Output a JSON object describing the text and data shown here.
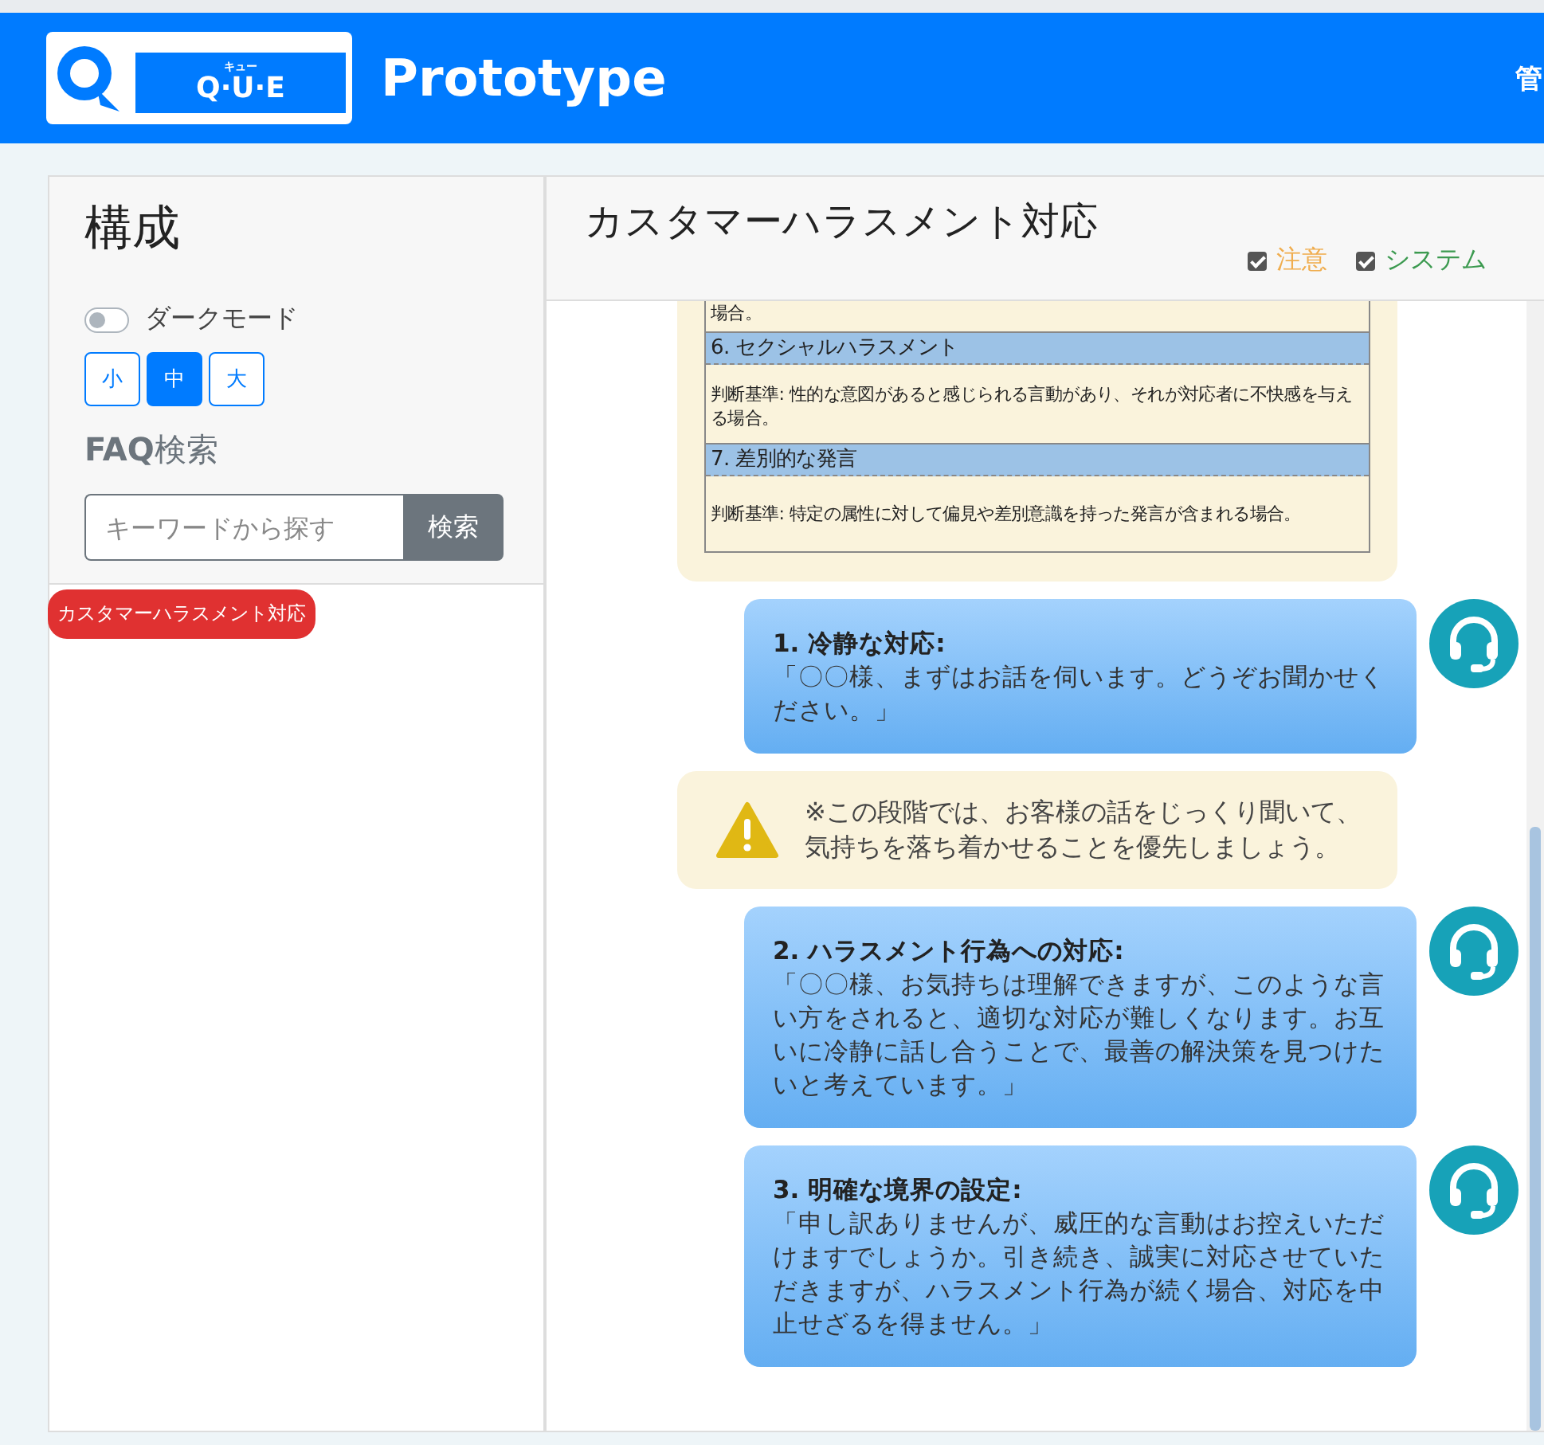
{
  "header": {
    "logo": {
      "ruby": "キュー",
      "text": "Q·U·E"
    },
    "title": "Prototype",
    "user": "管"
  },
  "sidebar": {
    "title": "構成",
    "dark_mode": {
      "label": "ダークモード",
      "on": false
    },
    "font_sizes": [
      {
        "label": "小",
        "selected": false
      },
      {
        "label": "中",
        "selected": true
      },
      {
        "label": "大",
        "selected": false
      }
    ],
    "faq_title": "**FAQ**検索",
    "search": {
      "placeholder": "キーワードから探す",
      "button": "検索"
    },
    "tags": [
      {
        "label": "カスタマーハラスメント対応"
      }
    ]
  },
  "main": {
    "title": "カスタマーハラスメント対応",
    "filters": [
      {
        "label": "注意",
        "checked": true,
        "color": "#f0ad4e"
      },
      {
        "label": "システム",
        "checked": true,
        "color": "#3c9a50"
      }
    ],
    "messages": [
      {
        "kind": "table",
        "rows": [
          {
            "kind": "text",
            "text": "場合。"
          },
          {
            "kind": "heading",
            "text": "6. セクシャルハラスメント"
          },
          {
            "kind": "text",
            "text": "判断基準: 性的な意図があると感じられる言動があり、それが対応者に不快感を与える場合。"
          },
          {
            "kind": "heading",
            "text": "7. 差別的な発言"
          },
          {
            "kind": "text",
            "text": "判断基準: 特定の属性に対して偏見や差別意識を持った発言が含まれる場合。"
          }
        ]
      },
      {
        "kind": "bot",
        "title": "1. 冷静な対応:",
        "text": "「〇〇様、まずはお話を伺います。どうぞお聞かせください。」"
      },
      {
        "kind": "warning",
        "text": "※この段階では、お客様の話をじっくり聞いて、気持ちを落ち着かせることを優先しましょう。"
      },
      {
        "kind": "bot",
        "title": "2. ハラスメント行為への対応:",
        "text": "「〇〇様、お気持ちは理解できますが、このような言い方をされると、適切な対応が難しくなります。お互いに冷静に話し合うことで、最善の解決策を見つけたいと考えています。」"
      },
      {
        "kind": "bot",
        "title": "3. 明確な境界の設定:",
        "text": "「申し訳ありませんが、威圧的な言動はお控えいただけますでしょうか。引き続き、誠実に対応させていただきますが、ハラスメント行為が続く場合、対応を中止せざるを得ません。」"
      }
    ]
  }
}
